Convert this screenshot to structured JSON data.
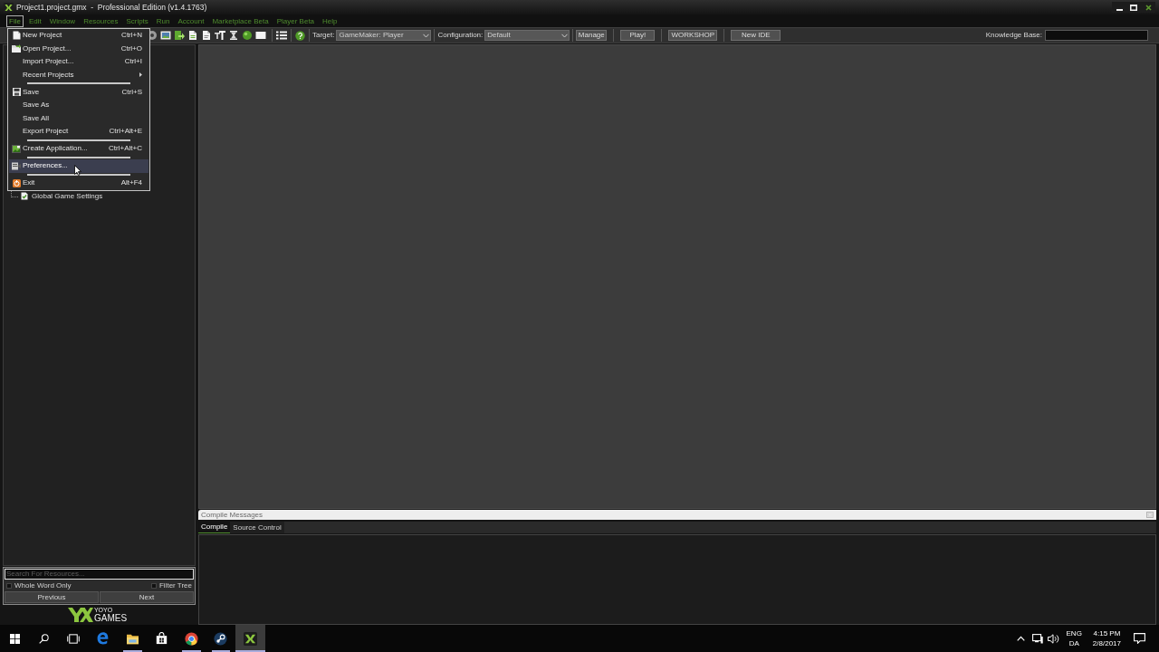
{
  "window": {
    "title": "Project1.project.gmx  -  Professional Edition (v1.4.1763)"
  },
  "menu_bar": [
    {
      "label": "File",
      "selected": true
    },
    {
      "label": "Edit",
      "selected": false
    },
    {
      "label": "Window",
      "selected": false
    },
    {
      "label": "Resources",
      "selected": false
    },
    {
      "label": "Scripts",
      "selected": false
    },
    {
      "label": "Run",
      "selected": false
    },
    {
      "label": "Account",
      "selected": false
    },
    {
      "label": "Marketplace Beta",
      "selected": false
    },
    {
      "label": "Player Beta",
      "selected": false
    },
    {
      "label": "Help",
      "selected": false
    }
  ],
  "file_menu": {
    "sections": [
      {
        "items": [
          {
            "label": "New Project",
            "shortcut": "Ctrl+N",
            "submenu": false,
            "selected": false
          },
          {
            "label": "Open Project...",
            "shortcut": "Ctrl+O",
            "submenu": false,
            "selected": false
          },
          {
            "label": "Import Project...",
            "shortcut": "Ctrl+I",
            "submenu": false,
            "selected": false
          },
          {
            "label": "Recent Projects",
            "submenu": true,
            "selected": false
          }
        ]
      },
      {
        "items": [
          {
            "label": "Save",
            "shortcut": "Ctrl+S",
            "submenu": false,
            "selected": false
          },
          {
            "label": "Save As",
            "submenu": false,
            "selected": false
          },
          {
            "label": "Save All",
            "submenu": false,
            "selected": false
          },
          {
            "label": "Export Project",
            "shortcut": "Ctrl+Alt+E",
            "submenu": false,
            "selected": false
          }
        ]
      },
      {
        "items": [
          {
            "label": "Create Application...",
            "shortcut": "Ctrl+Alt+C",
            "submenu": false,
            "selected": false
          }
        ]
      },
      {
        "items": [
          {
            "label": "Preferences...",
            "submenu": false,
            "selected": true
          }
        ]
      },
      {
        "items": [
          {
            "label": "Exit",
            "shortcut": "Alt+F4",
            "submenu": false,
            "selected": false
          }
        ]
      }
    ]
  },
  "toolbar": {
    "target": {
      "label": "Target:",
      "value": "GameMaker: Player"
    },
    "configuration": {
      "label": "Configuration:",
      "value": "Default"
    },
    "buttons": [
      "Manage",
      "Play!",
      "WORKSHOP",
      "New IDE"
    ],
    "knowledge_base": {
      "label": "Knowledge Base:"
    }
  },
  "resource_tree": {
    "items": [
      {
        "label": "Global Game Settings",
        "selected": false
      }
    ]
  },
  "resource_search": {
    "placeholder": "Search For Resources...",
    "options": [
      {
        "label": "Whole Word Only",
        "checked": false
      },
      {
        "label": "Filter Tree",
        "checked": false
      }
    ],
    "buttons": [
      "Previous",
      "Next"
    ]
  },
  "logo": {
    "line_1": "YOYO",
    "line_2": "GAMES"
  },
  "compile_messages": {
    "title": "Compile Messages",
    "tabs": [
      {
        "label": "Compile",
        "selected": true
      },
      {
        "label": "Source Control",
        "selected": false
      }
    ]
  },
  "taskbar": {
    "apps": [
      {
        "running": false,
        "selected": false
      },
      {
        "running": true,
        "selected": false
      },
      {
        "running": false,
        "selected": false
      },
      {
        "running": true,
        "selected": false
      },
      {
        "running": true,
        "selected": false
      },
      {
        "running": true,
        "selected": true
      }
    ],
    "tray": {
      "language": "ENG",
      "layout": "DA",
      "time": "4:15 PM",
      "date": "2/8/2017"
    }
  }
}
